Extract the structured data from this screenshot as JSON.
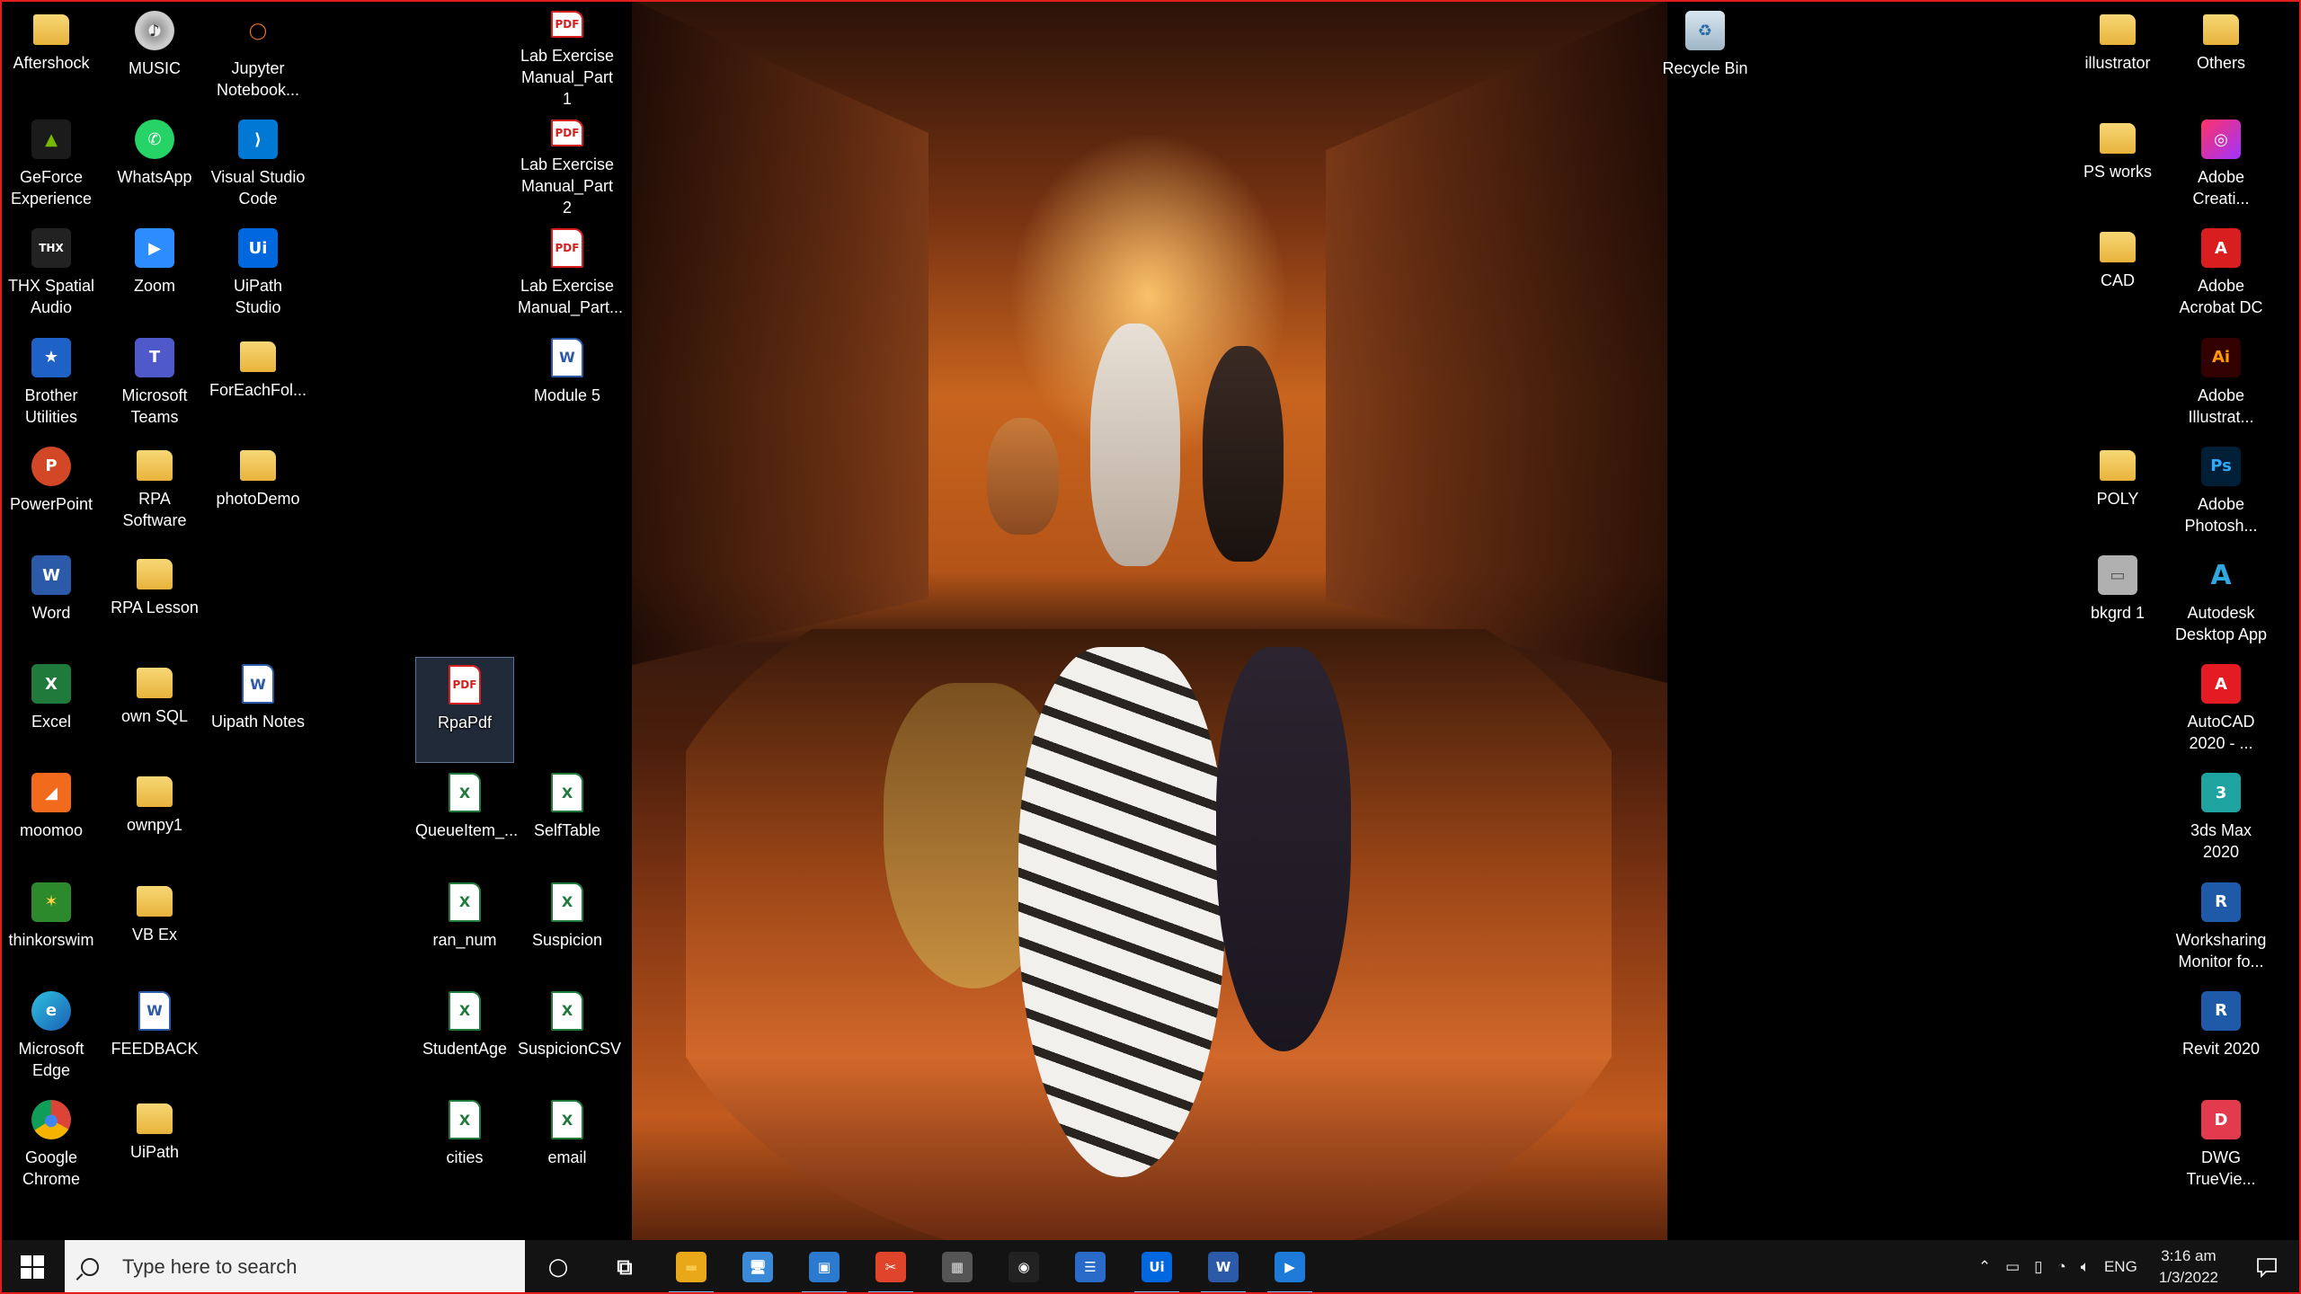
{
  "desktop": {
    "icons_col1": [
      {
        "label": "Aftershock",
        "icon": "folder-icon"
      },
      {
        "label": "GeForce Experience",
        "icon": "geforce-icon"
      },
      {
        "label": "THX Spatial Audio",
        "icon": "thx-icon"
      },
      {
        "label": "Brother Utilities",
        "icon": "brother-icon"
      },
      {
        "label": "PowerPoint",
        "icon": "powerpoint-icon"
      },
      {
        "label": "Word",
        "icon": "word-icon"
      },
      {
        "label": "Excel",
        "icon": "excel-icon"
      },
      {
        "label": "moomoo",
        "icon": "moomoo-icon"
      },
      {
        "label": "thinkorswim",
        "icon": "thinkorswim-icon"
      },
      {
        "label": "Microsoft Edge",
        "icon": "edge-icon"
      },
      {
        "label": "Google Chrome",
        "icon": "chrome-icon"
      }
    ],
    "icons_col2": [
      {
        "label": "MUSIC",
        "icon": "music-icon"
      },
      {
        "label": "WhatsApp",
        "icon": "whatsapp-icon"
      },
      {
        "label": "Zoom",
        "icon": "zoom-icon"
      },
      {
        "label": "Microsoft Teams",
        "icon": "teams-icon"
      },
      {
        "label": "RPA Software",
        "icon": "folder-icon"
      },
      {
        "label": "RPA Lesson",
        "icon": "folder-icon"
      },
      {
        "label": "own SQL",
        "icon": "folder-icon"
      },
      {
        "label": "ownpy1",
        "icon": "folder-icon"
      },
      {
        "label": "VB Ex",
        "icon": "folder-icon"
      },
      {
        "label": "FEEDBACK",
        "icon": "word-doc-icon"
      },
      {
        "label": "UiPath",
        "icon": "folder-icon"
      }
    ],
    "icons_col3": [
      {
        "label": "Jupyter Notebook...",
        "icon": "jupyter-icon"
      },
      {
        "label": "Visual Studio Code",
        "icon": "vscode-icon"
      },
      {
        "label": "UiPath Studio",
        "icon": "uipath-icon"
      },
      {
        "label": "ForEachFol...",
        "icon": "folder-icon"
      },
      {
        "label": "photoDemo",
        "icon": "folder-icon"
      },
      {
        "label": "Uipath Notes",
        "icon": "word-doc-icon"
      }
    ],
    "icons_col5": [
      {
        "label": "Lab Exercise Manual_Part 1",
        "icon": "pdf-icon"
      },
      {
        "label": "Lab Exercise Manual_Part 2",
        "icon": "pdf-icon"
      },
      {
        "label": "Lab Exercise Manual_Part...",
        "icon": "pdf-icon"
      },
      {
        "label": "Module 5",
        "icon": "word-doc-icon"
      },
      {
        "label": "SelfTable",
        "icon": "excel-file-icon"
      },
      {
        "label": "Suspicion",
        "icon": "excel-file-icon"
      },
      {
        "label": "SuspicionCSV",
        "icon": "excel-file-icon"
      },
      {
        "label": "email",
        "icon": "excel-file-icon"
      }
    ],
    "icons_col4": [
      {
        "label": "RpaPdf",
        "icon": "pdf-icon"
      },
      {
        "label": "QueueItem_...",
        "icon": "excel-file-icon"
      },
      {
        "label": "ran_num",
        "icon": "excel-file-icon"
      },
      {
        "label": "StudentAge",
        "icon": "excel-file-icon"
      },
      {
        "label": "cities",
        "icon": "excel-file-icon"
      }
    ],
    "recycle_bin": {
      "label": "Recycle Bin",
      "icon": "recycle-bin-icon"
    },
    "icons_right1": [
      {
        "label": "illustrator",
        "icon": "folder-icon"
      },
      {
        "label": "PS works",
        "icon": "folder-icon"
      },
      {
        "label": "CAD",
        "icon": "folder-icon"
      },
      {
        "label": "POLY",
        "icon": "folder-icon"
      },
      {
        "label": "bkgrd 1",
        "icon": "image-icon"
      }
    ],
    "icons_right2": [
      {
        "label": "Others",
        "icon": "folder-icon"
      },
      {
        "label": "Adobe Creati...",
        "icon": "creative-cloud-icon"
      },
      {
        "label": "Adobe Acrobat DC",
        "icon": "acrobat-icon"
      },
      {
        "label": "Adobe Illustrat...",
        "icon": "illustrator-icon"
      },
      {
        "label": "Adobe Photosh...",
        "icon": "photoshop-icon"
      },
      {
        "label": "Autodesk Desktop App",
        "icon": "autodesk-icon"
      },
      {
        "label": "AutoCAD 2020 - ...",
        "icon": "autocad-icon"
      },
      {
        "label": "3ds Max 2020",
        "icon": "3dsmax-icon"
      },
      {
        "label": "Worksharing Monitor fo...",
        "icon": "revit-icon"
      },
      {
        "label": "Revit 2020",
        "icon": "revit-icon"
      },
      {
        "label": "DWG TrueVie...",
        "icon": "dwg-icon"
      }
    ]
  },
  "taskbar": {
    "search_placeholder": "Type here to search",
    "apps": [
      {
        "name": "cortana-icon",
        "glyph": "○"
      },
      {
        "name": "task-view-icon",
        "glyph": "⧉"
      },
      {
        "name": "file-explorer-icon",
        "glyph": "▬",
        "running": true
      },
      {
        "name": "remote-desktop-icon",
        "glyph": "🖥"
      },
      {
        "name": "network-monitor-icon",
        "glyph": "▣",
        "running": true
      },
      {
        "name": "snipping-tool-icon",
        "glyph": "✂",
        "running": true
      },
      {
        "name": "calculator-icon",
        "glyph": "▦"
      },
      {
        "name": "media-player-icon",
        "glyph": "◉"
      },
      {
        "name": "settings-panel-icon",
        "glyph": "☰"
      },
      {
        "name": "uipath-taskbar-icon",
        "glyph": "Ui",
        "running": true
      },
      {
        "name": "word-taskbar-icon",
        "glyph": "W",
        "running": true
      },
      {
        "name": "video-player-icon",
        "glyph": "▶",
        "running": true
      }
    ],
    "tray": {
      "language": "ENG",
      "time": "3:16 am",
      "date": "1/3/2022"
    }
  }
}
